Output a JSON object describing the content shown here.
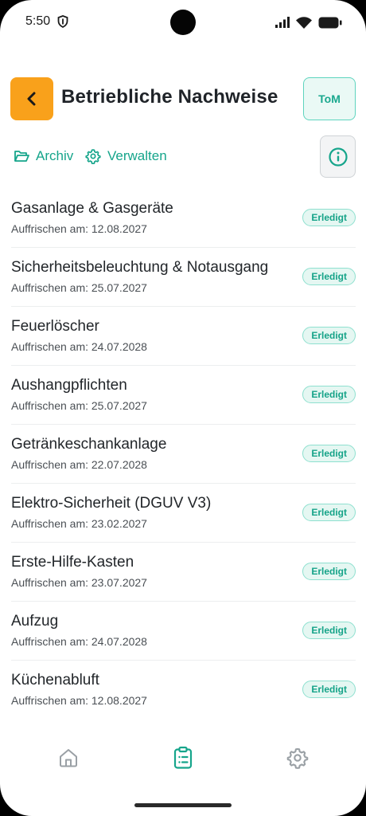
{
  "status_bar": {
    "time": "5:50"
  },
  "header": {
    "title": "Betriebliche Nachweise",
    "avatar_initials": "ToM"
  },
  "actions": {
    "archiv_label": "Archiv",
    "verwalten_label": "Verwalten"
  },
  "colors": {
    "accent_orange": "#F9A11B",
    "accent_teal": "#16A58B",
    "badge_bg": "#E5F7F2"
  },
  "items": [
    {
      "title": "Gasanlage & Gasgeräte",
      "subtitle": "Auffrischen am: 12.08.2027",
      "status": "Erledigt"
    },
    {
      "title": "Sicherheitsbeleuchtung & Notausgang",
      "subtitle": "Auffrischen am: 25.07.2027",
      "status": "Erledigt"
    },
    {
      "title": "Feuerlöscher",
      "subtitle": "Auffrischen am: 24.07.2028",
      "status": "Erledigt"
    },
    {
      "title": "Aushangpflichten",
      "subtitle": "Auffrischen am: 25.07.2027",
      "status": "Erledigt"
    },
    {
      "title": "Getränkeschankanlage",
      "subtitle": "Auffrischen am: 22.07.2028",
      "status": "Erledigt"
    },
    {
      "title": "Elektro-Sicherheit (DGUV V3)",
      "subtitle": "Auffrischen am: 23.02.2027",
      "status": "Erledigt"
    },
    {
      "title": "Erste-Hilfe-Kasten",
      "subtitle": "Auffrischen am: 23.07.2027",
      "status": "Erledigt"
    },
    {
      "title": "Aufzug",
      "subtitle": "Auffrischen am: 24.07.2028",
      "status": "Erledigt"
    },
    {
      "title": "Küchenabluft",
      "subtitle": "Auffrischen am: 12.08.2027",
      "status": "Erledigt"
    }
  ],
  "bottom_nav": {
    "icons": [
      "home-icon",
      "checklist-icon",
      "gear-icon"
    ],
    "active_index": 1
  }
}
